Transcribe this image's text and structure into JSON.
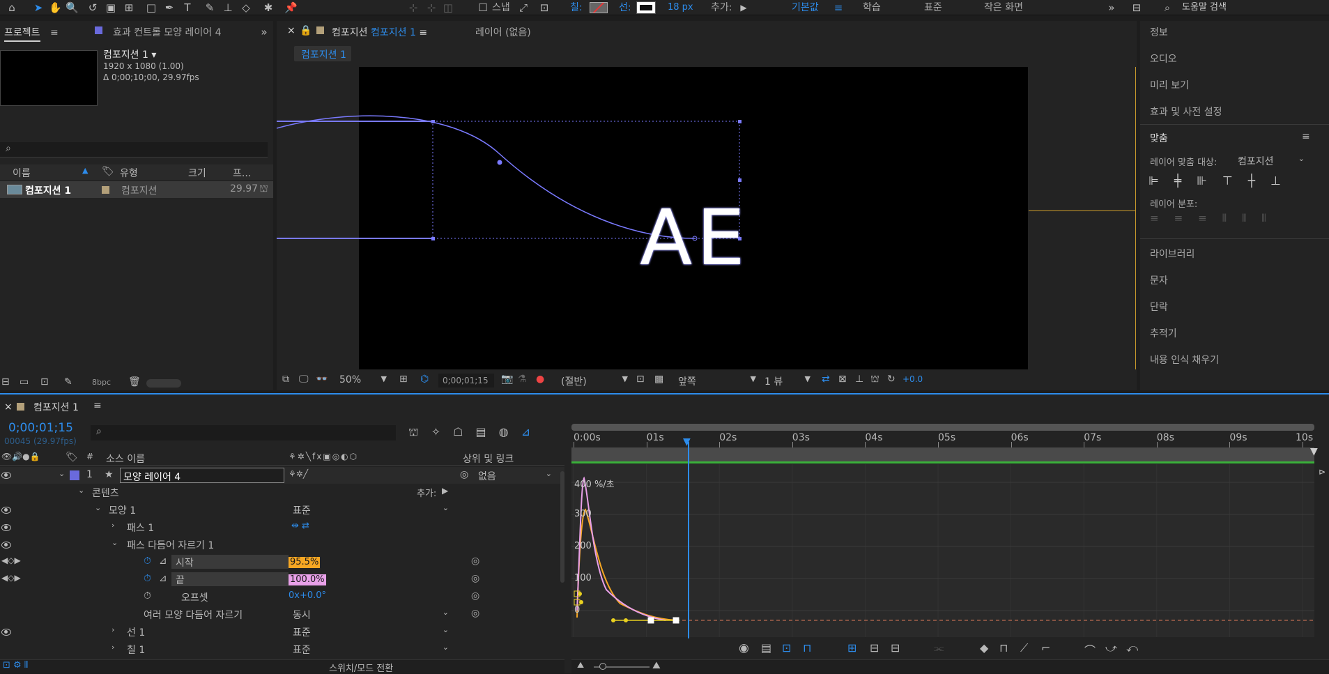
{
  "app": {
    "accent": "#2d8ceb",
    "background": "#1d1d1d",
    "panel": "#232323"
  },
  "toolbar": {
    "fill_label": "칠:",
    "stroke_label": "선:",
    "stroke_width": "18 px",
    "add_label": "추가:",
    "snap_label": "스냅",
    "workspaces": [
      "기본값",
      "학습",
      "표준",
      "작은 화면"
    ],
    "active_workspace": "기본값",
    "search_placeholder": "도움말 검색",
    "icons": [
      "home-icon",
      "selection-arrow-icon",
      "hand-icon",
      "zoom-icon",
      "rotate-icon",
      "camera-icon",
      "pan-behind-icon",
      "rectangle-icon",
      "pen-icon",
      "text-icon",
      "brush-icon",
      "stamp-icon",
      "eraser-icon",
      "roto-brush-icon",
      "puppet-pin-icon"
    ]
  },
  "project": {
    "tab_label": "프로젝트",
    "effects_tab": "효과 컨트롤 모양 레이어 4",
    "comp_name": "컴포지션 1 ▾",
    "comp_size": "1920 x 1080 (1.00)",
    "comp_duration": "Δ 0;00;10;00, 29.97fps",
    "columns": {
      "name": "이름",
      "type": "유형",
      "size": "크기",
      "fps": "프..."
    },
    "item": {
      "name": "컴포지션 1",
      "type": "컴포지션",
      "fps": "29.97"
    },
    "bpc": "8bpc"
  },
  "viewer": {
    "tab_prefix": "컴포지션",
    "tab_name": "컴포지션 1",
    "layer_tab": "레이어 (없음)",
    "breadcrumb": "컴포지션 1",
    "text": "AE",
    "zoom": "50%",
    "timecode": "0;00;01;15",
    "resolution": "(절반)",
    "view": "앞쪽",
    "views": "1 뷰",
    "exposure": "+0.0"
  },
  "right_panel": {
    "items": [
      "정보",
      "오디오",
      "미리 보기",
      "효과 및 사전 설정"
    ],
    "align_title": "맞춤",
    "align_to_label": "레이어 맞춤 대상:",
    "align_to_value": "컴포지션",
    "distribute_label": "레이어 분포:",
    "lower_items": [
      "라이브러리",
      "문자",
      "단락",
      "추적기",
      "내용 인식 채우기"
    ]
  },
  "timeline": {
    "tab_name": "컴포지션 1",
    "timecode": "0;00;01;15",
    "frame_info": "00045 (29.97fps)",
    "col_num": "#",
    "col_source": "소스 이름",
    "col_parent": "상위 및 링크",
    "layer": {
      "num": "1",
      "name": "모양 레이어 4",
      "parent": "없음"
    },
    "contents_label": "콘텐츠",
    "add_label": "추가:",
    "rows": [
      {
        "label": "모양 1",
        "value": "표준"
      },
      {
        "label": "패스 1",
        "value": ""
      },
      {
        "label": "패스 다듬어 자르기 1",
        "value": ""
      },
      {
        "label": "시작",
        "value": "95.5%"
      },
      {
        "label": "끝",
        "value": "100.0%"
      },
      {
        "label": "오프셋",
        "value": "0x+0.0°"
      },
      {
        "label": "여러 모양 다듬어 자르기",
        "value": "동시"
      },
      {
        "label": "선 1",
        "value": "표준"
      },
      {
        "label": "칠 1",
        "value": "표준"
      }
    ],
    "switch_mode": "스위치/모드 전환",
    "ruler": [
      "0:00s",
      "01s",
      "02s",
      "03s",
      "04s",
      "05s",
      "06s",
      "07s",
      "08s",
      "09s",
      "10s"
    ],
    "graph_unit": "400 %/초",
    "graph_ticks": [
      "400",
      "300",
      "200",
      "100",
      "0"
    ],
    "start_color": "#f5a623",
    "end_color": "#e8a0e8"
  }
}
